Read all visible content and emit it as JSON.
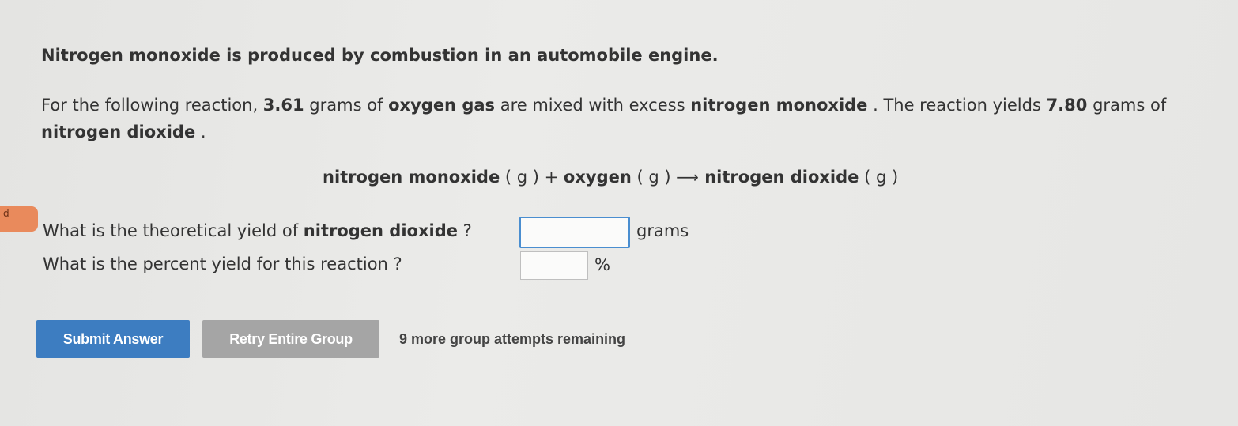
{
  "intro": "Nitrogen monoxide is produced by combustion in an automobile engine.",
  "paragraph": {
    "p1": "For the following reaction, ",
    "mass_o2": "3.61",
    "p2": " grams of ",
    "oxygen_gas": "oxygen gas",
    "p3": " are mixed with excess ",
    "nitrogen_monoxide": "nitrogen monoxide",
    "p4": " . The reaction yields ",
    "mass_no2": "7.80",
    "p5": " grams of ",
    "nitrogen_dioxide": "nitrogen dioxide",
    "p6": " ."
  },
  "equation": {
    "reactant1": "nitrogen monoxide",
    "state1": " ( g ) + ",
    "reactant2": "oxygen",
    "state2": " ( g ) ",
    "arrow": "⟶",
    "product": " nitrogen dioxide",
    "state3": " ( g )"
  },
  "marker_label": "d",
  "question1": {
    "prefix": "What is the theoretical yield of ",
    "bold": "nitrogen dioxide",
    "suffix": " ?",
    "value": "",
    "unit": "grams"
  },
  "question2": {
    "text": "What is the percent yield for this reaction ?",
    "value": "",
    "unit": "%"
  },
  "buttons": {
    "submit": "Submit Answer",
    "retry": "Retry Entire Group"
  },
  "attempts": "9 more group attempts remaining",
  "colors": {
    "submit_bg": "#3d7dc1",
    "retry_bg": "#a5a5a5",
    "focus_border": "#4a8ed0",
    "marker": "#e98a5c"
  }
}
